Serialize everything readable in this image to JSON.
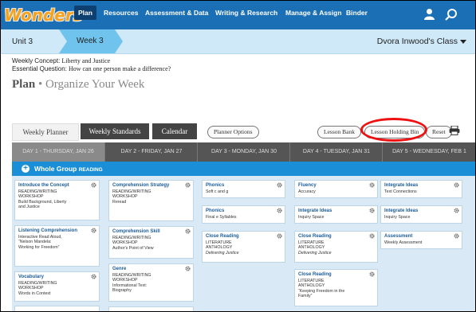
{
  "nav": {
    "logo": "Wonders",
    "items": [
      "Plan",
      "Resources",
      "Assessment & Data",
      "Writing & Research",
      "Manage & Assign",
      "Binder"
    ]
  },
  "unitbar": {
    "unit": "Unit 3",
    "week": "Week 3",
    "class": "Dvora Inwood's Class"
  },
  "concept": {
    "concept_label": "Weekly Concept:",
    "concept_value": "Liberty and Justice",
    "question_label": "Essential Question:",
    "question_value": "How can one person make a difference?"
  },
  "page": {
    "plan": "Plan",
    "sep": " • ",
    "title": "Organize Your Week"
  },
  "tabs": [
    "Weekly Planner",
    "Weekly Standards",
    "Calendar"
  ],
  "buttons": {
    "options": "Planner Options",
    "bank": "Lesson Bank",
    "holding": "Lesson Holding Bin",
    "reset": "Reset"
  },
  "days": [
    "DAY 1 - THURSDAY, JAN 26",
    "DAY 2 - FRIDAY, JAN 27",
    "DAY 3 - MONDAY, JAN 30",
    "DAY 4 - TUESDAY, JAN 31",
    "DAY 5 - WEDNESDAY, FEB 1"
  ],
  "group": {
    "label": "Whole Group",
    "sub": "READING"
  },
  "columns": [
    [
      {
        "title": "Introduce the Concept",
        "lines": [
          "READING/WRITING",
          "WORKSHOP",
          "Build Background, Liberty",
          "and Justice"
        ]
      },
      {
        "title": "Listening Comprehension",
        "lines": [
          "Interactive Read Aloud,",
          "“Nelson Mandela:",
          "Working for Freedom”"
        ]
      },
      {
        "title": "Vocabulary",
        "lines": [
          "READING/WRITING",
          "WORKSHOP",
          "Words in Context"
        ]
      }
    ],
    [
      {
        "title": "Comprehension Strategy",
        "lines": [
          "READING/WRITING",
          "WORKSHOP",
          "Reread"
        ]
      },
      {
        "title": "Comprehension Skill",
        "lines": [
          "READING/WRITING",
          "WORKSHOP",
          "Author's Point of View"
        ]
      },
      {
        "title": "Genre",
        "lines": [
          "READING/WRITING",
          "WORKSHOP",
          "Informational Text:",
          "Biography"
        ]
      }
    ],
    [
      {
        "title": "Phonics",
        "lines": [
          "Soft c and g"
        ]
      },
      {
        "title": "Phonics",
        "lines": [
          "Final e Syllables"
        ]
      },
      {
        "title": "Close Reading",
        "lines": [
          "LITERATURE",
          "ANTHOLOGY"
        ],
        "italic": "Delivering Justice"
      }
    ],
    [
      {
        "title": "Fluency",
        "lines": [
          "Accuracy"
        ]
      },
      {
        "title": "Integrate Ideas",
        "lines": [
          "Inquiry Space"
        ]
      },
      {
        "title": "Close Reading",
        "lines": [
          "LITERATURE",
          "ANTHOLOGY"
        ],
        "italic": "Delivering Justice"
      },
      {
        "title": "Close Reading",
        "lines": [
          "LITERATURE",
          "ANTHOLOGY",
          "“Keeping Freedom in the",
          "Family”"
        ]
      }
    ],
    [
      {
        "title": "Integrate Ideas",
        "lines": [
          "Text Connections"
        ]
      },
      {
        "title": "Integrate Ideas",
        "lines": [
          "Inquiry Space"
        ]
      },
      {
        "title": "Assessment",
        "lines": [
          "Weekly Assessment"
        ]
      }
    ]
  ],
  "colors": {
    "nav": "#1a6fb5",
    "navActive": "#0d3f70",
    "unitbar": "#cfe9f8",
    "week": "#6fc3ec",
    "group": "#1a8fd7",
    "cardTitle": "#1b5c99",
    "highlight": "#e11"
  }
}
